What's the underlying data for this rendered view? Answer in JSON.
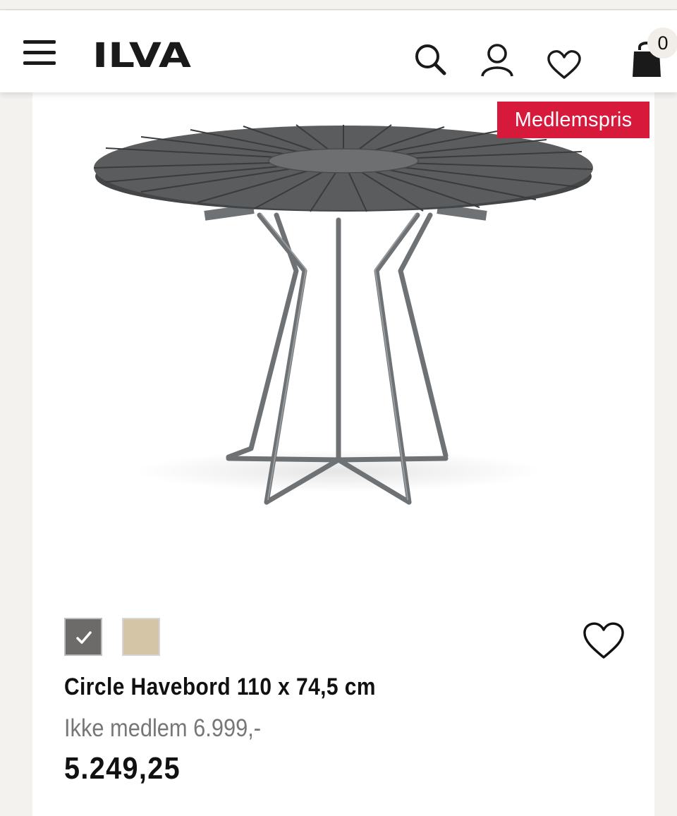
{
  "header": {
    "logo_text": "ILVA",
    "cart_count": "0",
    "icons": [
      "menu-icon",
      "search-icon",
      "user-icon",
      "heart-icon",
      "shopping-bag-icon"
    ]
  },
  "product": {
    "badge": "Medlemspris",
    "name": "Circle Havebord 110 x 74,5 cm",
    "regular_price": "Ikke medlem 6.999,-",
    "member_price": "5.249,25",
    "colors": [
      {
        "name": "dark-grey",
        "hex": "#6d6b69",
        "selected": true
      },
      {
        "name": "sand",
        "hex": "#d3c5a6",
        "selected": false
      }
    ]
  },
  "colors": {
    "badge_red": "#d71a3c",
    "page_bg": "#f4f2ef"
  }
}
